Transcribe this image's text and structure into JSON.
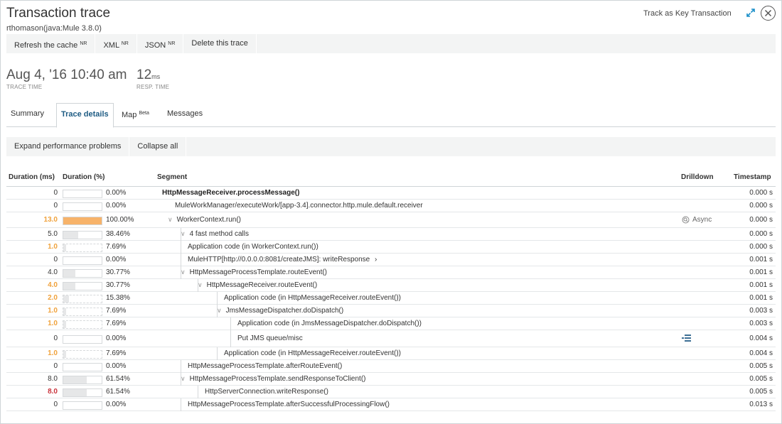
{
  "header": {
    "title": "Transaction trace",
    "subtitle": "rthomason(java:Mule 3.8.0)",
    "track_link": "Track as Key Transaction"
  },
  "toolbar": [
    {
      "label": "Refresh the cache",
      "sup": "NR"
    },
    {
      "label": "XML",
      "sup": "NR"
    },
    {
      "label": "JSON",
      "sup": "NR"
    },
    {
      "label": "Delete this trace",
      "sup": ""
    }
  ],
  "metrics": {
    "trace_time_value": "Aug 4, '16 10:40 am",
    "trace_time_label": "TRACE TIME",
    "resp_time_value": "12",
    "resp_time_unit": "ms",
    "resp_time_label": "RESP. TIME"
  },
  "tabs": [
    {
      "label": "Summary",
      "sup": "",
      "active": false
    },
    {
      "label": "Trace details",
      "sup": "",
      "active": true
    },
    {
      "label": "Map",
      "sup": "Beta",
      "active": false
    },
    {
      "label": "Messages",
      "sup": "",
      "active": false
    }
  ],
  "actions": {
    "expand": "Expand performance problems",
    "collapse": "Collapse all"
  },
  "columns": {
    "duration_ms": "Duration (ms)",
    "duration_pct": "Duration (%)",
    "segment": "Segment",
    "drilldown": "Drilldown",
    "timestamp": "Timestamp"
  },
  "rows": [
    {
      "dur": "0",
      "sev": "",
      "pct": "0.00%",
      "fraction": 0,
      "dashed": false,
      "seg": "HttpMessageReceiver.processMessage()",
      "indent": 0,
      "bold": true,
      "chevron": false,
      "arrow": false,
      "drill": "",
      "ts": "0.000 s"
    },
    {
      "dur": "0",
      "sev": "",
      "pct": "0.00%",
      "fraction": 0,
      "dashed": false,
      "seg": "MuleWorkManager/executeWork/[app-3.4].connector.http.mule.default.receiver",
      "indent": 1,
      "bold": false,
      "chevron": false,
      "arrow": false,
      "drill": "",
      "ts": "0.000 s"
    },
    {
      "dur": "13.0",
      "sev": "warn",
      "pct": "100.00%",
      "fraction": 1,
      "dashed": false,
      "seg": "WorkerContext.run()",
      "indent": 1,
      "bold": false,
      "chevron": true,
      "arrow": false,
      "drill": "Async",
      "ts": "0.000 s"
    },
    {
      "dur": "5.0",
      "sev": "",
      "pct": "38.46%",
      "fraction": 0.3846,
      "dashed": false,
      "seg": "4 fast method calls",
      "indent": 2,
      "bold": false,
      "chevron": true,
      "arrow": false,
      "drill": "",
      "ts": "0.000 s"
    },
    {
      "dur": "1.0",
      "sev": "warn",
      "pct": "7.69%",
      "fraction": 0.0769,
      "dashed": true,
      "seg": "Application code (in WorkerContext.run())",
      "indent": 3,
      "bold": false,
      "chevron": false,
      "arrow": false,
      "drill": "",
      "ts": "0.000 s"
    },
    {
      "dur": "0",
      "sev": "",
      "pct": "0.00%",
      "fraction": 0,
      "dashed": false,
      "seg": "MuleHTTP[http://0.0.0.0:8081/createJMS]: writeResponse",
      "indent": 3,
      "bold": false,
      "chevron": false,
      "arrow": true,
      "drill": "",
      "ts": "0.001 s"
    },
    {
      "dur": "4.0",
      "sev": "",
      "pct": "30.77%",
      "fraction": 0.3077,
      "dashed": false,
      "seg": "HttpMessageProcessTemplate.routeEvent()",
      "indent": 3,
      "bold": false,
      "chevron": true,
      "arrow": false,
      "drill": "",
      "ts": "0.001 s"
    },
    {
      "dur": "4.0",
      "sev": "warn",
      "pct": "30.77%",
      "fraction": 0.3077,
      "dashed": false,
      "seg": "HttpMessageReceiver.routeEvent()",
      "indent": 4,
      "bold": false,
      "chevron": true,
      "arrow": false,
      "drill": "",
      "ts": "0.001 s"
    },
    {
      "dur": "2.0",
      "sev": "warn",
      "pct": "15.38%",
      "fraction": 0.1538,
      "dashed": true,
      "seg": "Application code (in HttpMessageReceiver.routeEvent())",
      "indent": 5,
      "bold": false,
      "chevron": false,
      "arrow": false,
      "drill": "",
      "ts": "0.001 s"
    },
    {
      "dur": "1.0",
      "sev": "warn",
      "pct": "7.69%",
      "fraction": 0.0769,
      "dashed": true,
      "seg": "JmsMessageDispatcher.doDispatch()",
      "indent": 5,
      "bold": false,
      "chevron": true,
      "arrow": false,
      "drill": "",
      "ts": "0.003 s"
    },
    {
      "dur": "1.0",
      "sev": "warn",
      "pct": "7.69%",
      "fraction": 0.0769,
      "dashed": true,
      "seg": "Application code (in JmsMessageDispatcher.doDispatch())",
      "indent": 6,
      "bold": false,
      "chevron": false,
      "arrow": false,
      "drill": "",
      "ts": "0.003 s"
    },
    {
      "dur": "0",
      "sev": "",
      "pct": "0.00%",
      "fraction": 0,
      "dashed": false,
      "seg": "Put JMS queue/misc",
      "indent": 6,
      "bold": false,
      "chevron": false,
      "arrow": false,
      "drill": "db",
      "ts": "0.004 s"
    },
    {
      "dur": "1.0",
      "sev": "warn",
      "pct": "7.69%",
      "fraction": 0.0769,
      "dashed": true,
      "seg": "Application code (in HttpMessageReceiver.routeEvent())",
      "indent": 5,
      "bold": false,
      "chevron": false,
      "arrow": false,
      "drill": "",
      "ts": "0.004 s"
    },
    {
      "dur": "0",
      "sev": "",
      "pct": "0.00%",
      "fraction": 0,
      "dashed": false,
      "seg": "HttpMessageProcessTemplate.afterRouteEvent()",
      "indent": 3,
      "bold": false,
      "chevron": false,
      "arrow": false,
      "drill": "",
      "ts": "0.005 s"
    },
    {
      "dur": "8.0",
      "sev": "",
      "pct": "61.54%",
      "fraction": 0.6154,
      "dashed": false,
      "seg": "HttpMessageProcessTemplate.sendResponseToClient()",
      "indent": 3,
      "bold": false,
      "chevron": true,
      "arrow": false,
      "drill": "",
      "ts": "0.005 s"
    },
    {
      "dur": "8.0",
      "sev": "crit",
      "pct": "61.54%",
      "fraction": 0.6154,
      "dashed": false,
      "seg": "HttpServerConnection.writeResponse()",
      "indent": 4,
      "bold": false,
      "chevron": false,
      "arrow": false,
      "drill": "",
      "ts": "0.005 s"
    },
    {
      "dur": "0",
      "sev": "",
      "pct": "0.00%",
      "fraction": 0,
      "dashed": false,
      "seg": "HttpMessageProcessTemplate.afterSuccessfulProcessingFlow()",
      "indent": 3,
      "bold": false,
      "chevron": false,
      "arrow": false,
      "drill": "",
      "ts": "0.013 s"
    }
  ]
}
